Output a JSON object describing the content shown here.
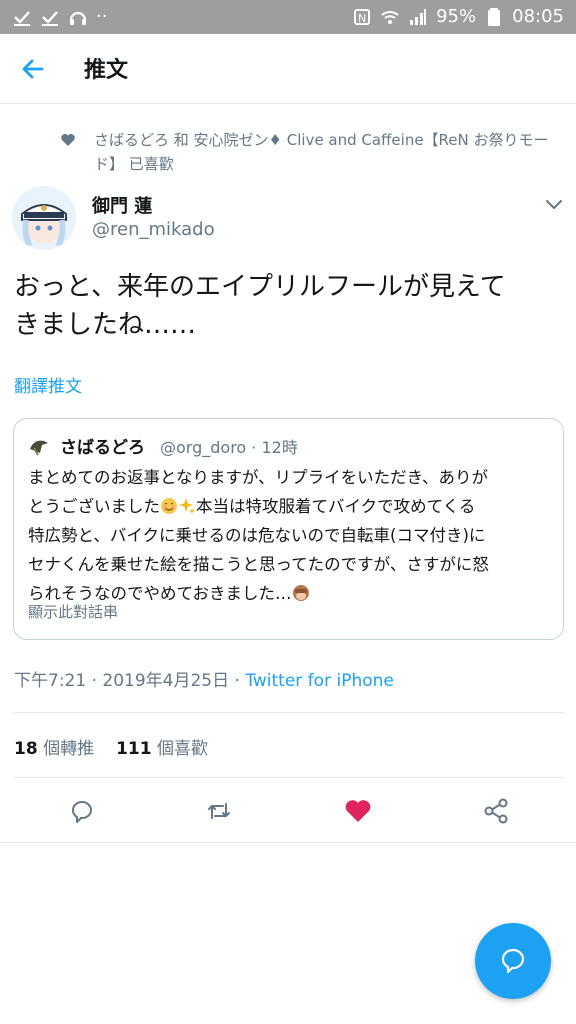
{
  "status_bar": {
    "battery": "95%",
    "time": "08:05"
  },
  "header": {
    "title": "推文"
  },
  "liked_by": {
    "text": "さばるどろ 和 安心院ゼン♦ Clive and Caffeine【ReN お祭りモード】 已喜歡"
  },
  "author": {
    "name": "御門 蓮",
    "handle": "@ren_mikado"
  },
  "tweet": {
    "line1": "おっと、来年のエイプリルフールが見えて",
    "line2": "きましたね……",
    "translate_label": "翻譯推文"
  },
  "quoted": {
    "name": "さばるどろ",
    "meta": "@org_doro · 12時",
    "line1": "まとめてのお返事となりますが、リプライをいただき、ありが",
    "line2_pre": "とうございました",
    "line2_post": "本当は特攻服着てバイクで攻めてくる",
    "line3": "特広勢と、バイクに乗せるのは危ないので自転車(コマ付き)に",
    "line4": "セナくんを乗せた絵を描こうと思ってたのですが、さすがに怒",
    "line5": "られそうなのでやめておきました…",
    "thread_label": "顯示此對話串"
  },
  "meta": {
    "timestamp": "下午7:21 · 2019年4月25日 · ",
    "source": "Twitter for iPhone"
  },
  "stats": {
    "retweets_count": "18",
    "retweets_label": "個轉推",
    "likes_count": "111",
    "likes_label": "個喜歡"
  },
  "colors": {
    "accent": "#1da1f2",
    "like": "#e0245e",
    "secondary_text": "#657786",
    "status_bar": "#9e9e9e"
  },
  "icons": [
    "check-icon",
    "download-icon",
    "wifi-icon",
    "signal-icon",
    "battery-icon",
    "back-arrow-icon",
    "heart-icon",
    "chevron-down-icon",
    "reply-icon",
    "retweet-icon",
    "like-icon",
    "share-icon",
    "compose-icon"
  ]
}
